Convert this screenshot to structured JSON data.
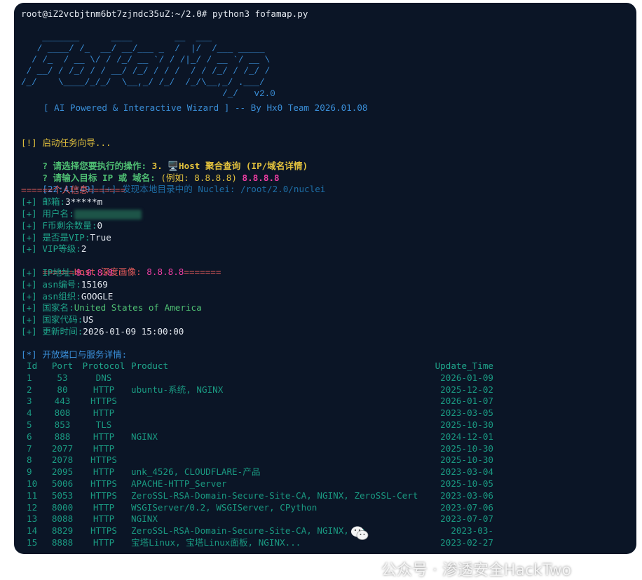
{
  "prompt": "root@iZ2vcbjtnm6bt7zjndc35uZ:~/2.0# python3 fofamap.py",
  "banner": {
    "art": "    _______      ____        __  ___\n   / ____/ /_  __/ __/___ _  /  |/  /___ _____\n  / /_  / __ \\/ / /_/ __ `/ / /|_/ / __ `/ __ \\\n / __/ / /_/ / / __/ /_/ / / /  / / /_/ / /_/ /\n/_/    \\____/_/_/  \\__,_/ /_/  /_/\\__,_/ .___/\n                                      /_/   v2.0",
    "tagline": "[ AI Powered & Interactive Wizard ] -- By Hx0 Team 2026.01.08"
  },
  "wizard": {
    "start": "[!] 启动任务向导...",
    "q1_prefix": "? 请选择您要执行的操作: ",
    "q1_choice": "3. 🖥️Host 聚合查询 (IP/域名详情)",
    "q2_prefix": "? 请输入目标 IP 或 域名: ",
    "q2_hint": "(例如: 8.8.8.8)",
    "q2_value": "8.8.8.8",
    "nuclei_time": "[22:41:49]",
    "nuclei_msg": " [+] 发现本地目录中的 Nuclei: /root/2.0/nuclei"
  },
  "personal": {
    "header": "======个人信息=======",
    "lines": [
      {
        "label": "[+] 邮箱:",
        "value": "3*****m"
      },
      {
        "label": "[+] 用户名:",
        "value": ""
      },
      {
        "label": "[+] F币剩余数量:",
        "value": "0"
      },
      {
        "label": "[+] 是否是VIP:",
        "value": "True"
      },
      {
        "label": "[+] VIP等级:",
        "value": "2"
      }
    ]
  },
  "host": {
    "header_left": "======Host 深度画像: ",
    "header_ip": "8.8.8.8",
    "header_right": "=======",
    "lines": [
      {
        "label": "[+] IP地址:",
        "value": "8.8.8.8"
      },
      {
        "label": "[+] asn编号:",
        "value": "15169"
      },
      {
        "label": "[+] asn组织:",
        "value": "GOOGLE"
      },
      {
        "label": "[+] 国家名:",
        "value": "United States of America"
      },
      {
        "label": "[+] 国家代码:",
        "value": "US"
      },
      {
        "label": "[+] 更新时间:",
        "value": "2026-01-09 15:00:00"
      }
    ]
  },
  "ports": {
    "title": "[*] 开放端口与服务详情:",
    "headers": {
      "id": "Id",
      "port": "Port",
      "protocol": "Protocol",
      "product": "Product",
      "update": "Update_Time"
    },
    "rows": [
      {
        "id": "1",
        "port": "53",
        "protocol": "DNS",
        "product": "",
        "update": "2026-01-09"
      },
      {
        "id": "2",
        "port": "80",
        "protocol": "HTTP",
        "product": "ubuntu-系统, NGINX",
        "update": "2025-12-02"
      },
      {
        "id": "3",
        "port": "443",
        "protocol": "HTTPS",
        "product": "",
        "update": "2026-01-07"
      },
      {
        "id": "4",
        "port": "808",
        "protocol": "HTTP",
        "product": "",
        "update": "2023-03-05"
      },
      {
        "id": "5",
        "port": "853",
        "protocol": "TLS",
        "product": "",
        "update": "2025-10-30"
      },
      {
        "id": "6",
        "port": "888",
        "protocol": "HTTP",
        "product": "NGINX",
        "update": "2024-12-01"
      },
      {
        "id": "7",
        "port": "2077",
        "protocol": "HTTP",
        "product": "",
        "update": "2025-10-30"
      },
      {
        "id": "8",
        "port": "2078",
        "protocol": "HTTPS",
        "product": "",
        "update": "2025-10-30"
      },
      {
        "id": "9",
        "port": "2095",
        "protocol": "HTTP",
        "product": "unk_4526, CLOUDFLARE-产品",
        "update": "2023-03-04"
      },
      {
        "id": "10",
        "port": "5006",
        "protocol": "HTTPS",
        "product": "APACHE-HTTP_Server",
        "update": "2025-10-05"
      },
      {
        "id": "11",
        "port": "5053",
        "protocol": "HTTPS",
        "product": "ZeroSSL-RSA-Domain-Secure-Site-CA, NGINX, ZeroSSL-Cert",
        "update": "2023-03-06"
      },
      {
        "id": "12",
        "port": "8000",
        "protocol": "HTTP",
        "product": "WSGIServer/0.2, WSGIServer, CPython",
        "update": "2023-07-06"
      },
      {
        "id": "13",
        "port": "8088",
        "protocol": "HTTP",
        "product": "NGINX",
        "update": "2023-07-07"
      },
      {
        "id": "14",
        "port": "8829",
        "protocol": "HTTPS",
        "product": "ZeroSSL-RSA-Domain-Secure-Site-CA, NGINX, Ze",
        "update": "2023-03-"
      },
      {
        "id": "15",
        "port": "8888",
        "protocol": "HTTP",
        "product": "宝塔Linux, 宝塔Linux面板, NGINX...",
        "update": "2023-02-27"
      }
    ]
  },
  "watermark": "公众号 · 渗透安全HackTwo",
  "colors": {
    "background": "#0b1526",
    "prompt": "#e3e8ef",
    "banner": "#3a8fd9",
    "wizard": "#e3c23d",
    "accent": "#ee3ea2",
    "section": "#e35a5a",
    "info": "#4fbf73",
    "table": "#1fa58b"
  }
}
